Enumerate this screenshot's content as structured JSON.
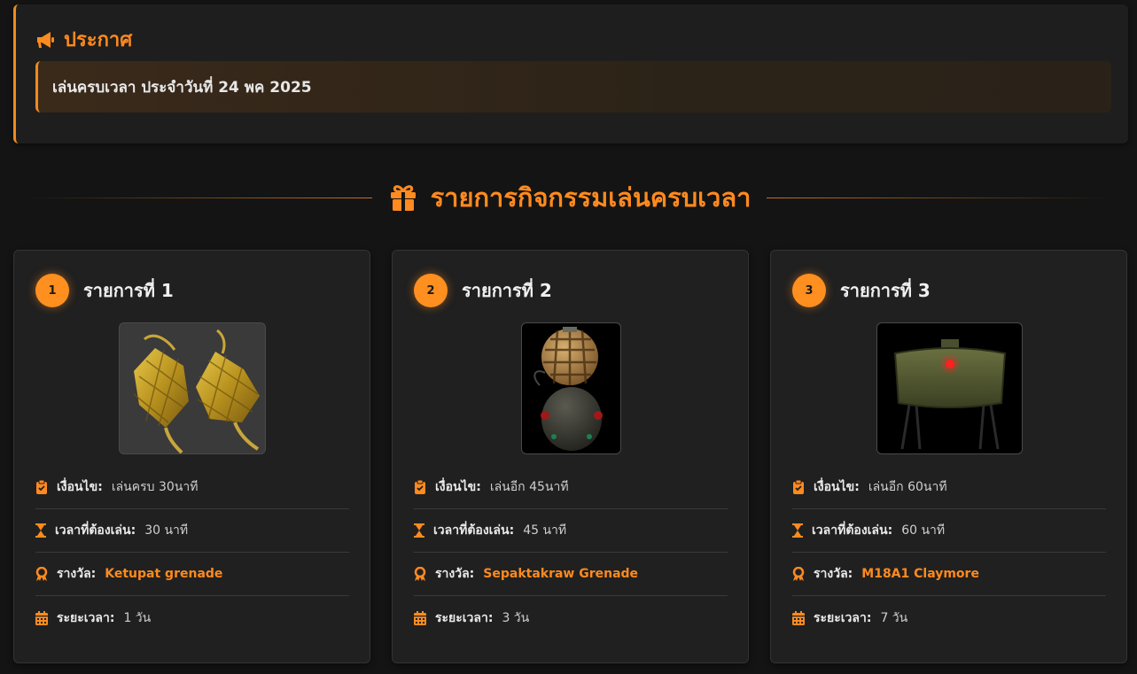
{
  "announcement": {
    "title": "ประกาศ",
    "message": "เล่นครบเวลา ประจำวันที่ 24 พค 2025"
  },
  "section": {
    "title": "รายการกิจกรรมเล่นครบเวลา"
  },
  "labels": {
    "condition": "เงื่อนไข:",
    "time_required": "เวลาที่ต้องเล่น:",
    "reward": "รางวัล:",
    "duration": "ระยะเวลา:"
  },
  "cards": [
    {
      "number": "1",
      "title": "รายการที่ 1",
      "image_icon": "ketupat-grenade-image",
      "condition": "เล่นครบ 30นาที",
      "time_required": "30 นาที",
      "reward": "Ketupat grenade",
      "duration": "1 วัน"
    },
    {
      "number": "2",
      "title": "รายการที่ 2",
      "image_icon": "sepaktakraw-grenade-image",
      "condition": "เล่นอีก 45นาที",
      "time_required": "45 นาที",
      "reward": "Sepaktakraw Grenade",
      "duration": "3 วัน"
    },
    {
      "number": "3",
      "title": "รายการที่ 3",
      "image_icon": "claymore-mine-image",
      "condition": "เล่นอีก 60นาที",
      "time_required": "60 นาที",
      "reward": "M18A1 Claymore",
      "duration": "7 วัน"
    }
  ],
  "colors": {
    "accent": "#ff8a1f",
    "background": "#141414",
    "card": "#202020"
  }
}
